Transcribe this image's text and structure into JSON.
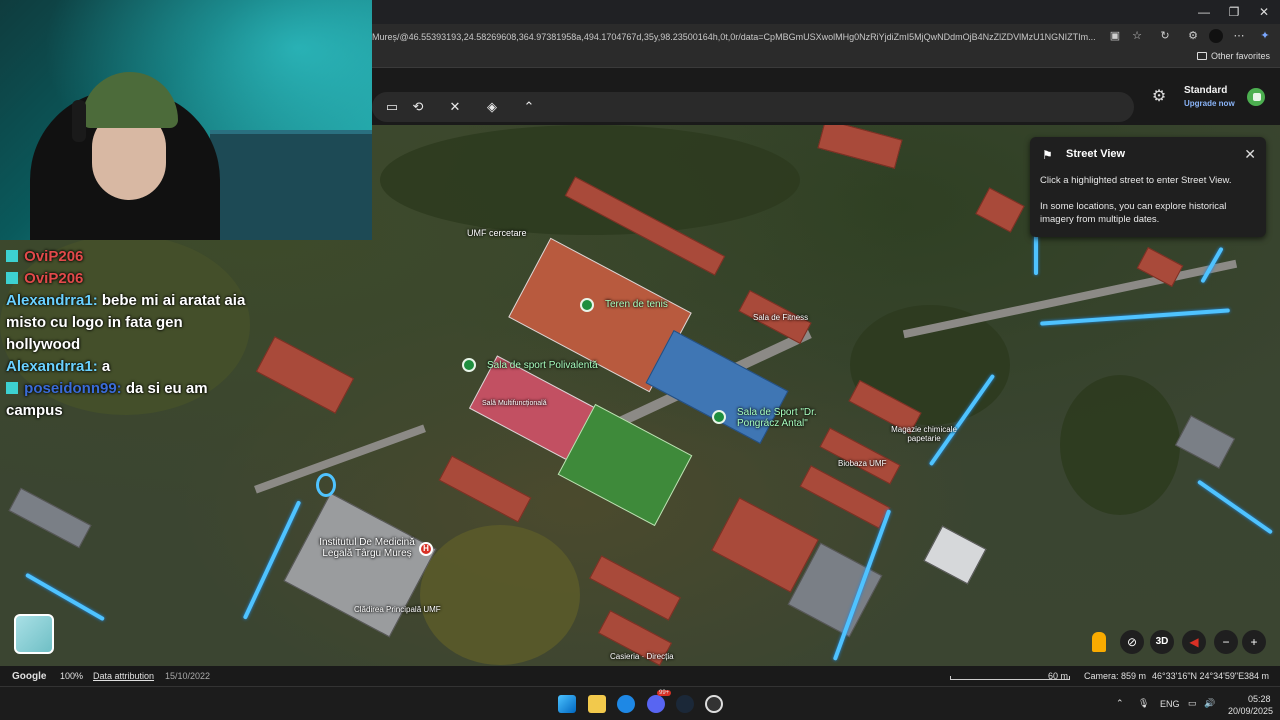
{
  "browser": {
    "url": "Mureș/@46.55393193,24.58269608,364.97381958a,494.1704767d,35y,98.23500164h,0t,0r/data=CpMBGmUSXwolMHg0NzRiYjdiZmI5MjQwNDdmOjB4NzZlZDVlMzU1NGNIZTIm...",
    "other_favorites": "Other favorites",
    "window_controls": [
      "—",
      "❐",
      "✕"
    ]
  },
  "earth_header": {
    "plan_label": "Standard",
    "upgrade_label": "Upgrade now"
  },
  "street_view_card": {
    "title": "Street View",
    "line1": "Click a highlighted street to enter Street View.",
    "line2": "In some locations, you can explore historical imagery from multiple dates."
  },
  "map_labels": {
    "umf_cercetare": "UMF cercetare",
    "teren_tenis": "Teren de tenis",
    "sala_fitness": "Sala de Fitness",
    "sala_polivalenta": "Sala de sport Polivalentă",
    "sala_multifunctionala": "Sală Multifuncțională",
    "sala_pongracz": "Sala de Sport \"Dr. Pongrácz Antal\"",
    "magazie": "Magazie chimicale papetarie",
    "biobaza": "Biobaza UMF",
    "institut": "Institutul De Medicină Legală Târgu Mureș",
    "cladirea": "Clădirea Principală UMF",
    "casieria": "Casieria · Direcția"
  },
  "chat": [
    {
      "user": "OviP206",
      "text": "",
      "color": "#e24a4a"
    },
    {
      "user": "OviP206",
      "text": "",
      "color": "#e24a4a"
    },
    {
      "user": "Alexandrra1:",
      "text": " bebe mi ai aratat aia misto cu logo in fata gen hollywood",
      "color": "#6ad1ff"
    },
    {
      "user": "Alexandrra1:",
      "text": " a",
      "color": "#6ad1ff"
    },
    {
      "user": "poseidonn99:",
      "text": " da si eu am campus",
      "color": "#3a6cd8"
    }
  ],
  "status": {
    "brand": "Google",
    "zoom": "100%",
    "attribution": "Data attribution",
    "date": "15/10/2022",
    "scale": "60 m",
    "camera": "Camera: 859 m",
    "coords": "46°33'16\"N 24°34'59\"E",
    "elevation": "384 m"
  },
  "map_controls": {
    "three_d": "3D",
    "minus": "−",
    "plus": "+"
  },
  "taskbar": {
    "lang": "ENG",
    "time": "05:28",
    "date": "20/09/2025",
    "discord_badge": "99+"
  }
}
